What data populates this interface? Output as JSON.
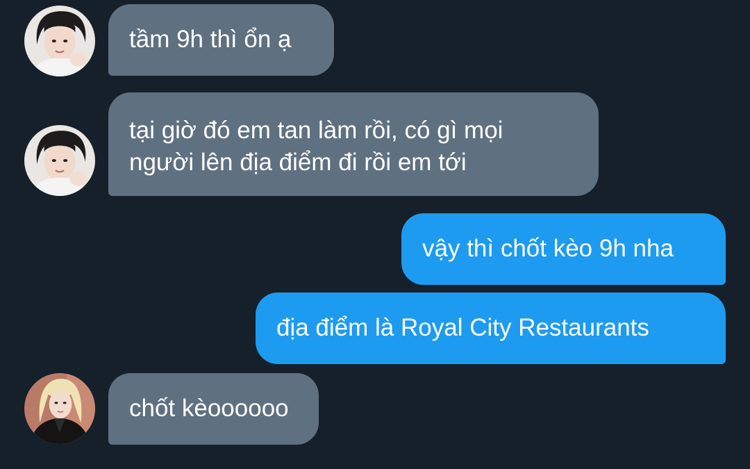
{
  "messages": [
    {
      "id": "m1",
      "direction": "incoming",
      "sender": "user-a",
      "lines": [
        "tầm 9h thì ổn ạ"
      ]
    },
    {
      "id": "m2",
      "direction": "incoming",
      "sender": "user-a",
      "lines": [
        "tại giờ đó em tan làm rồi, có gì mọi",
        "người lên địa điểm đi rồi em tới"
      ]
    },
    {
      "id": "m3",
      "direction": "outgoing",
      "sender": "me",
      "lines": [
        "vậy thì chốt kèo 9h nha"
      ]
    },
    {
      "id": "m4",
      "direction": "outgoing",
      "sender": "me",
      "lines": [
        "địa điểm là Royal City Restaurants"
      ]
    },
    {
      "id": "m5",
      "direction": "incoming",
      "sender": "user-b",
      "lines": [
        "chốt kèoooooo"
      ]
    }
  ],
  "colors": {
    "background": "#16202b",
    "incoming_bubble": "#5f7080",
    "outgoing_bubble": "#1d9bf0",
    "text": "#ffffff"
  }
}
